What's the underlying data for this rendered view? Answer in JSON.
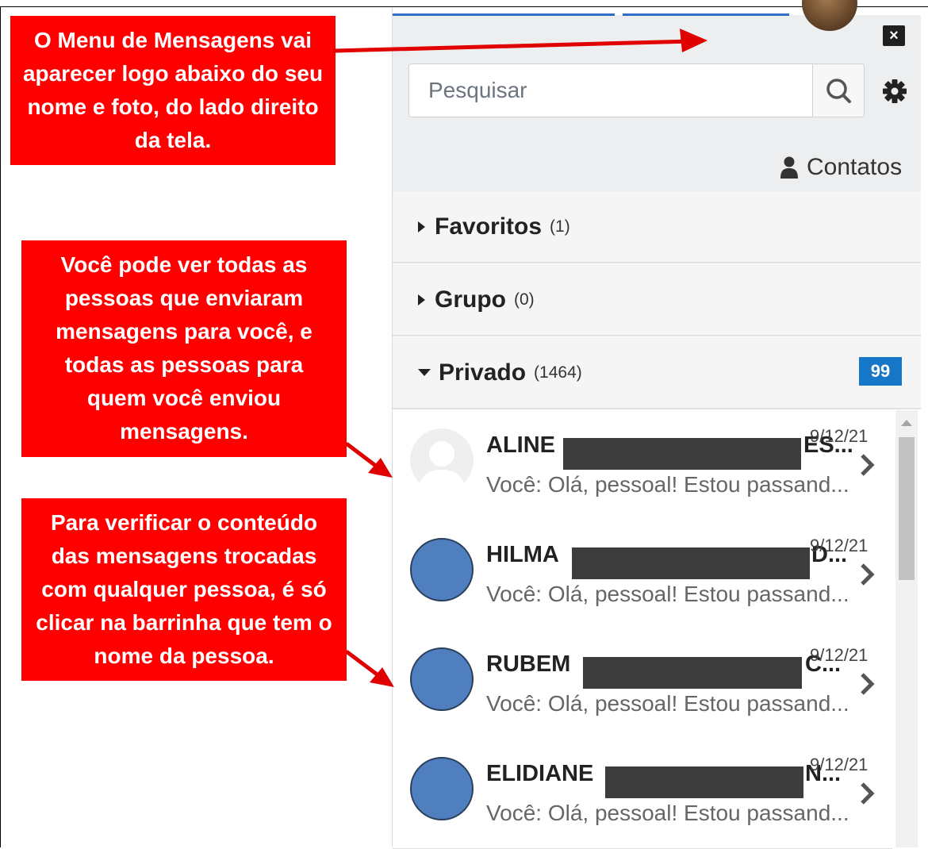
{
  "annotations": {
    "callout_1": "O Menu de Mensagens vai aparecer logo abaixo do seu nome e foto, do lado direito da tela.",
    "callout_2": "Você pode ver todas as pessoas que enviaram mensagens para você, e todas as pessoas para quem você enviou mensagens.",
    "callout_3": "Para verificar o conteúdo das mensagens trocadas com qualquer pessoa, é só clicar na barrinha que tem o nome da pessoa.",
    "color": "#ff0000"
  },
  "panel": {
    "close_label": "×",
    "search": {
      "placeholder": "Pesquisar"
    },
    "contacts_label": "Contatos",
    "sections": {
      "favorites": {
        "title": "Favoritos",
        "count": "(1)"
      },
      "group": {
        "title": "Grupo",
        "count": "(0)"
      },
      "private": {
        "title": "Privado",
        "count": "(1464)",
        "badge": "99"
      }
    },
    "conversations": [
      {
        "name_start": "ALINE",
        "name_end": "ES...",
        "date": "9/12/21",
        "preview": "Você: Olá, pessoal! Estou passand...",
        "avatar": "placeholder"
      },
      {
        "name_start": "HILMA",
        "name_end": "D...",
        "date": "9/12/21",
        "preview": "Você: Olá, pessoal! Estou passand...",
        "avatar": "blue"
      },
      {
        "name_start": "RUBEM",
        "name_end": "C...",
        "date": "9/12/21",
        "preview": "Você: Olá, pessoal! Estou passand...",
        "avatar": "blue"
      },
      {
        "name_start": "ELIDIANE",
        "name_end": "N...",
        "date": "9/12/21",
        "preview": "Você: Olá, pessoal! Estou passand...",
        "avatar": "blue"
      }
    ],
    "accent": "#1677c9",
    "avatar_color": "#4f7fbe"
  }
}
